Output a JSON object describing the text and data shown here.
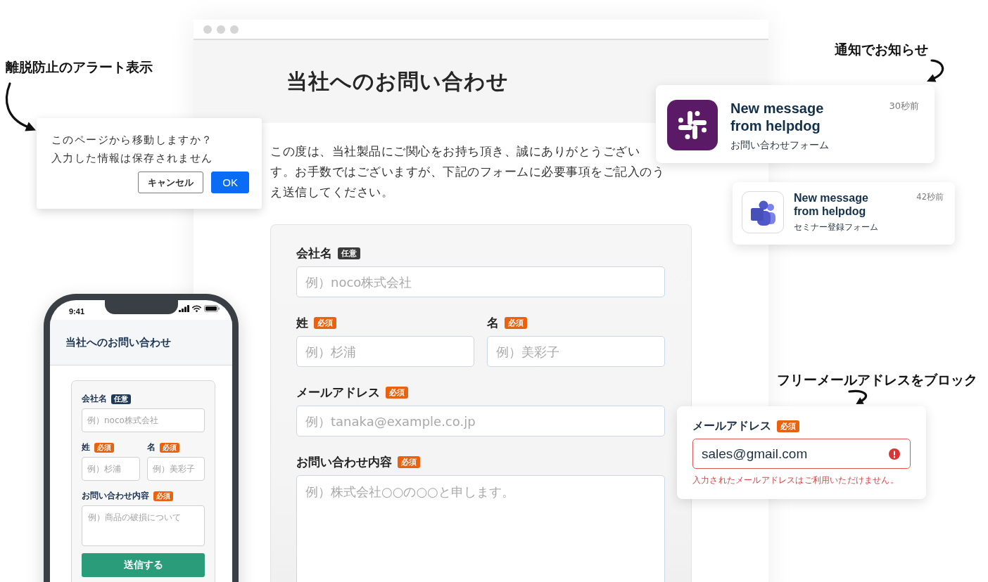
{
  "leave_alert": {
    "annotation": "離脱防止のアラート表示",
    "message_lines": [
      "このページから移動しますか？",
      "入力した情報は保存されません"
    ],
    "buttons": [
      {
        "label": "キャンセル",
        "kind": "secondary"
      },
      {
        "label": "OK",
        "kind": "primary"
      }
    ]
  },
  "browser": {
    "title": "当社へのお問い合わせ",
    "intro_lines": [
      "この度は、当社製品にご関心をお持ち頂き、誠にありがとうござい",
      "す。お手数ではございますが、下記のフォームに必要事項をご記入のう",
      "え送信してください。"
    ],
    "form": {
      "rows": [
        {
          "fields": [
            {
              "label": "会社名",
              "badge": {
                "text": "任意",
                "kind": "optional"
              },
              "kind": "text",
              "placeholder": "例）noco株式会社"
            }
          ]
        },
        {
          "fields": [
            {
              "label": "姓",
              "badge": {
                "text": "必須",
                "kind": "required"
              },
              "kind": "text",
              "placeholder": "例）杉浦"
            },
            {
              "label": "名",
              "badge": {
                "text": "必須",
                "kind": "required"
              },
              "kind": "text",
              "placeholder": "例）美彩子"
            }
          ]
        },
        {
          "fields": [
            {
              "label": "メールアドレス",
              "badge": {
                "text": "必須",
                "kind": "required"
              },
              "kind": "text",
              "placeholder": "例）tanaka@example.co.jp"
            }
          ]
        },
        {
          "fields": [
            {
              "label": "お問い合わせ内容",
              "badge": {
                "text": "必須",
                "kind": "required"
              },
              "kind": "textarea",
              "placeholder": "例）株式会社○○の○○と申します。"
            }
          ]
        }
      ]
    }
  },
  "notifications": {
    "annotation": "通知でお知らせ",
    "items": [
      {
        "kind": "primary",
        "title": "New message from helpdog",
        "time": "30秒前",
        "source": "お問い合わせフォーム"
      },
      {
        "kind": "secondary",
        "title": "New message from helpdog",
        "time": "42秒前",
        "source": "セミナー登録フォーム"
      }
    ]
  },
  "phone": {
    "time": "9:41",
    "title": "当社へのお問い合わせ",
    "form": {
      "rows": [
        {
          "fields": [
            {
              "label": "会社名",
              "badge": {
                "text": "任意",
                "kind": "optional"
              },
              "kind": "text",
              "placeholder": "例）noco株式会社"
            }
          ]
        },
        {
          "fields": [
            {
              "label": "姓",
              "badge": {
                "text": "必須",
                "kind": "required"
              },
              "kind": "text",
              "placeholder": "例）杉浦"
            },
            {
              "label": "名",
              "badge": {
                "text": "必須",
                "kind": "required"
              },
              "kind": "text",
              "placeholder": "例）美彩子"
            }
          ]
        },
        {
          "fields": [
            {
              "label": "お問い合わせ内容",
              "badge": {
                "text": "必須",
                "kind": "required"
              },
              "kind": "textarea",
              "placeholder": "例）商品の破損について"
            }
          ]
        }
      ]
    },
    "submit": "送信する"
  },
  "email_check": {
    "annotation": "フリーメールアドレスをブロック",
    "label": "メールアドレス",
    "badge": {
      "text": "必須",
      "kind": "required"
    },
    "value": "sales@gmail.com",
    "invalid": true,
    "error": "入力されたメールアドレスはご利用いただけません。"
  }
}
